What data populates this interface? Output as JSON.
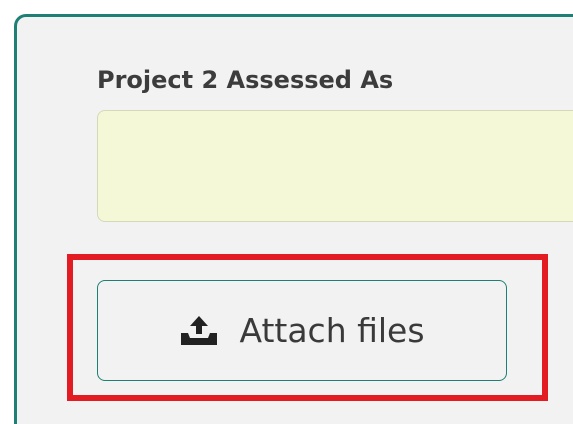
{
  "form": {
    "field_label": "Project 2 Assessed As",
    "field_value": "",
    "attach_button_label": "Attach files",
    "attach_icon": "upload-tray-icon"
  },
  "colors": {
    "panel_border": "#1e7f74",
    "panel_background": "#f2f2f2",
    "input_background": "#f5f8d6",
    "highlight_outline": "#e31b23",
    "text": "#3c3c3c"
  }
}
